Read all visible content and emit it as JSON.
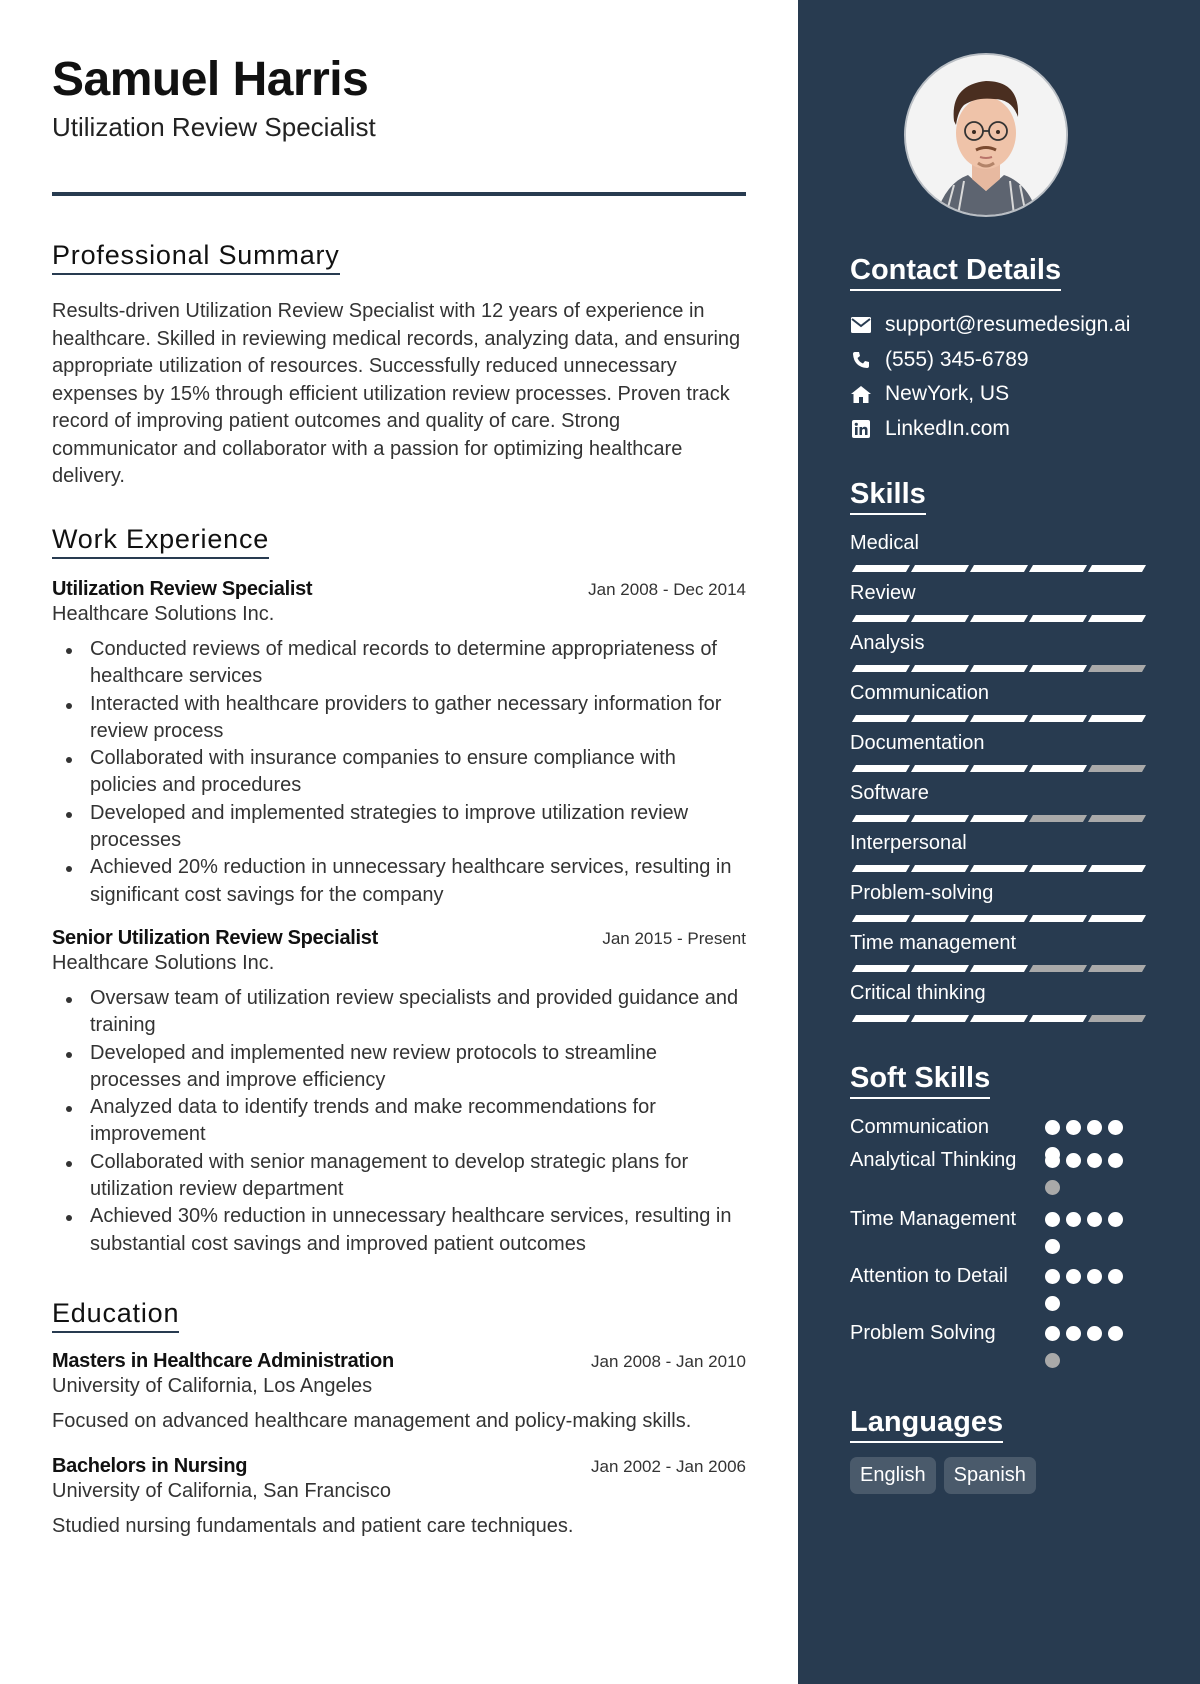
{
  "header": {
    "name": "Samuel Harris",
    "title": "Utilization Review Specialist"
  },
  "colors": {
    "sidebar": "#283b50",
    "accent_line": "#283b50",
    "rating_on": "#ffffff",
    "rating_off": "#a9a9a9",
    "language_chip": "#4a5a6b"
  },
  "summary": {
    "heading": "Professional Summary",
    "text": "Results-driven Utilization Review Specialist with 12 years of experience in healthcare. Skilled in reviewing medical records, analyzing data, and ensuring appropriate utilization of resources. Successfully reduced unnecessary expenses by 15% through efficient utilization review processes. Proven track record of improving patient outcomes and quality of care. Strong communicator and collaborator with a passion for optimizing healthcare delivery."
  },
  "experience": {
    "heading": "Work Experience",
    "jobs": [
      {
        "role": "Utilization Review Specialist",
        "dates": "Jan 2008 - Dec 2014",
        "company": "Healthcare Solutions Inc.",
        "bullets": [
          "Conducted reviews of medical records to determine appropriateness of healthcare services",
          "Interacted with healthcare providers to gather necessary information for review process",
          "Collaborated with insurance companies to ensure compliance with policies and procedures",
          "Developed and implemented strategies to improve utilization review processes",
          "Achieved 20% reduction in unnecessary healthcare services, resulting in significant cost savings for the company"
        ]
      },
      {
        "role": "Senior Utilization Review Specialist",
        "dates": "Jan 2015 - Present",
        "company": "Healthcare Solutions Inc.",
        "bullets": [
          "Oversaw team of utilization review specialists and provided guidance and training",
          "Developed and implemented new review protocols to streamline processes and improve efficiency",
          "Analyzed data to identify trends and make recommendations for improvement",
          "Collaborated with senior management to develop strategic plans for utilization review department",
          "Achieved 30% reduction in unnecessary healthcare services, resulting in substantial cost savings and improved patient outcomes"
        ]
      }
    ]
  },
  "education": {
    "heading": "Education",
    "items": [
      {
        "degree": "Masters in Healthcare Administration",
        "dates": "Jan 2008 - Jan 2010",
        "school": "University of California, Los Angeles",
        "description": "Focused on advanced healthcare management and policy-making skills."
      },
      {
        "degree": "Bachelors in Nursing",
        "dates": "Jan 2002 - Jan 2006",
        "school": "University of California, San Francisco",
        "description": "Studied nursing fundamentals and patient care techniques."
      }
    ]
  },
  "sidebar": {
    "avatar_alt": "profile-photo",
    "contact": {
      "heading": "Contact Details",
      "items": [
        {
          "icon": "envelope-icon",
          "text": "support@resumedesign.ai"
        },
        {
          "icon": "phone-icon",
          "text": "(555) 345-6789"
        },
        {
          "icon": "home-icon",
          "text": "NewYork, US"
        },
        {
          "icon": "linkedin-icon",
          "text": "LinkedIn.com"
        }
      ]
    },
    "skills": {
      "heading": "Skills",
      "max": 5,
      "items": [
        {
          "name": "Medical",
          "level": 5
        },
        {
          "name": "Review",
          "level": 5
        },
        {
          "name": "Analysis",
          "level": 4
        },
        {
          "name": "Communication",
          "level": 5
        },
        {
          "name": "Documentation",
          "level": 4
        },
        {
          "name": "Software",
          "level": 3
        },
        {
          "name": "Interpersonal",
          "level": 5
        },
        {
          "name": "Problem-solving",
          "level": 5
        },
        {
          "name": "Time management",
          "level": 3
        },
        {
          "name": "Critical thinking",
          "level": 4
        }
      ]
    },
    "soft_skills": {
      "heading": "Soft Skills",
      "max": 5,
      "items": [
        {
          "name": "Communication",
          "level": 5
        },
        {
          "name": "Analytical Thinking",
          "level": 4
        },
        {
          "name": "Time Management",
          "level": 5
        },
        {
          "name": "Attention to Detail",
          "level": 5
        },
        {
          "name": "Problem Solving",
          "level": 4
        }
      ]
    },
    "languages": {
      "heading": "Languages",
      "items": [
        "English",
        "Spanish"
      ]
    }
  }
}
